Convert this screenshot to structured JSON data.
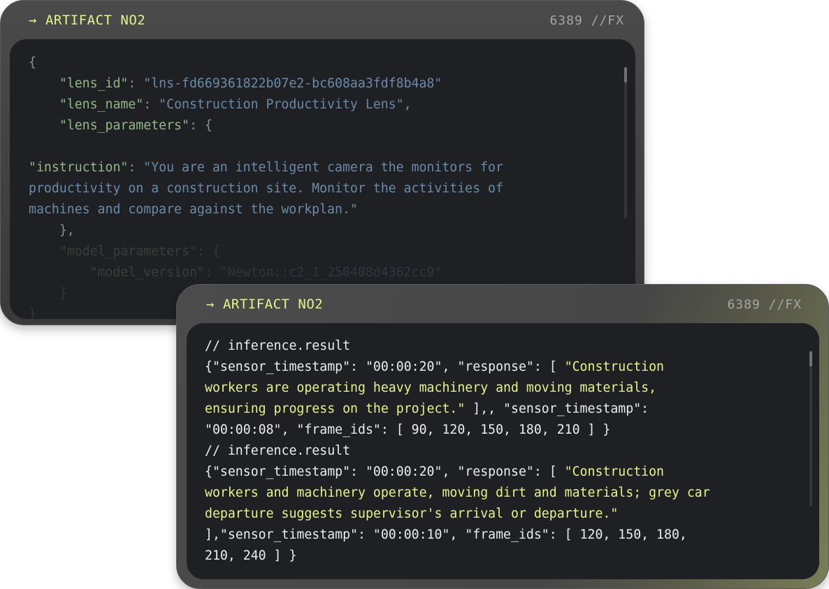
{
  "back_card": {
    "title": "ARTIFACT NO2",
    "meta": "6389 //FX",
    "code": {
      "l1": "{",
      "l2_key": "\"lens_id\"",
      "l2_sep": ": ",
      "l2_val": "\"lns-fd669361822b07e2-bc608aa3fdf8b4a8\"",
      "l3_key": "\"lens_name\"",
      "l3_sep": ": ",
      "l3_val": "\"Construction Productivity Lens\"",
      "l3_end": ",",
      "l4_key": "\"lens_parameters\"",
      "l4_sep": ": {",
      "l6_key": "\"instruction\"",
      "l6_sep": ": ",
      "l6_val": "\"You are an intelligent camera the monitors for",
      "l7_val": "productivity on a construction site. Monitor the activities of",
      "l8_val": "machines and compare against the workplan.\"",
      "l9": "},",
      "l10_key": "\"model_parameters\"",
      "l10_sep": ": {",
      "l11_key": "\"model_version\"",
      "l11_sep": ": ",
      "l11_val": "\"Newton::c2_1_250408d4362cc9\"",
      "l12": "}",
      "l13": "}"
    }
  },
  "front_card": {
    "title": "ARTIFACT NO2",
    "meta": "6389 //FX",
    "code": {
      "r1_comment": "// inference.result",
      "r1_a": "{\"sensor_timestamp\": \"00:00:20\", \"response\": [ ",
      "r1_b": "\"Construction",
      "r1_c": "workers are operating heavy machinery and moving materials,",
      "r1_d": "ensuring progress on the project.\"",
      "r1_e": " ],, \"sensor_timestamp\":",
      "r1_f": "\"00:00:08\", \"frame_ids\": [ 90, 120, 150, 180, 210 ] }",
      "r2_comment": "// inference.result",
      "r2_a": "{\"sensor_timestamp\": \"00:00:20\", \"response\": [ ",
      "r2_b": "\"Construction",
      "r2_c": "workers and machinery operate, moving dirt and materials; grey car",
      "r2_d": "departure suggests supervisor's arrival or departure.\"",
      "r2_e": "],\"sensor_timestamp\": \"00:00:10\", \"frame_ids\": [ 120, 150, 180,",
      "r2_f": "210, 240 ] }"
    }
  },
  "icons": {
    "title_arrow": "arrow-right-icon"
  },
  "colors": {
    "accent": "#e3f58c",
    "panel": "#1f2023",
    "card": "#444444"
  }
}
